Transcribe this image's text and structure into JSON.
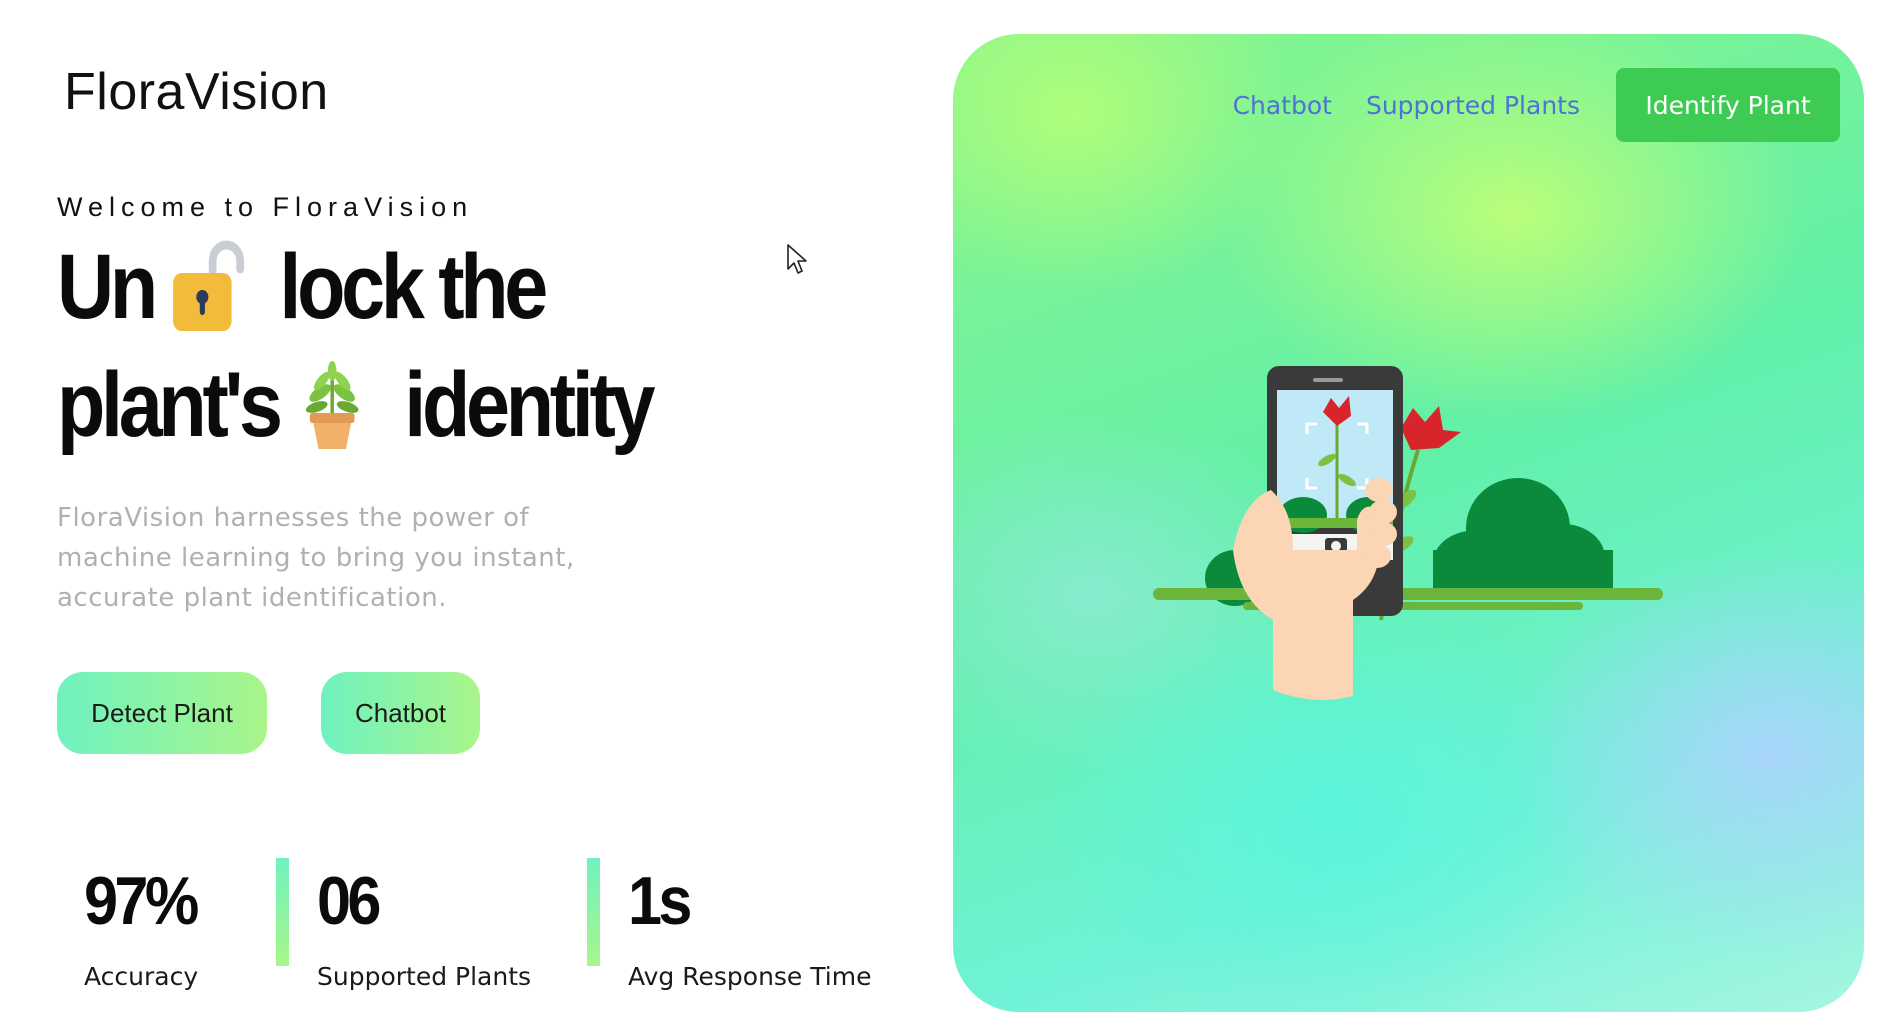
{
  "brand": {
    "name": "FloraVision"
  },
  "hero_text": {
    "welcome": "Welcome to FloraVision",
    "headline_line1_a": "Un",
    "headline_line1_b": "lock the",
    "headline_line2_a": "plant's",
    "headline_line2_b": "identity",
    "description": "FloraVision harnesses the power of machine learning to bring you instant, accurate plant identification."
  },
  "actions": {
    "detect_label": "Detect Plant",
    "chatbot_label": "Chatbot"
  },
  "stats": [
    {
      "value": "97%",
      "label": "Accuracy"
    },
    {
      "value": "06",
      "label": "Supported Plants"
    },
    {
      "value": "1s",
      "label": "Avg Response Time"
    }
  ],
  "nav": {
    "links": [
      "Chatbot",
      "Supported Plants"
    ],
    "cta": "Identify Plant"
  },
  "colors": {
    "accent_green": "#3ecb54",
    "nav_link": "#4f72d8",
    "button_gradient_start": "#6ff2c0",
    "button_gradient_end": "#a9f58a"
  },
  "icons": [
    "unlocked-padlock-icon",
    "potted-plant-icon",
    "camera-icon",
    "cursor-icon"
  ]
}
